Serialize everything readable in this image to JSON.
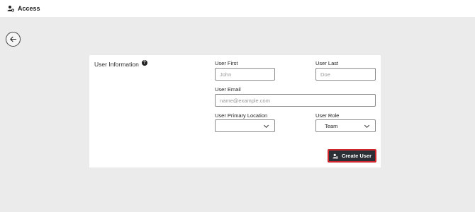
{
  "header": {
    "title": "Access",
    "icon": "user-gear-icon"
  },
  "back": {
    "icon": "arrow-left-icon"
  },
  "form": {
    "section_label": "User Information",
    "help_icon": "question-circle-icon",
    "user_first": {
      "label": "User First",
      "placeholder": "John",
      "value": ""
    },
    "user_last": {
      "label": "User Last",
      "placeholder": "Doe",
      "value": ""
    },
    "user_email": {
      "label": "User Email",
      "placeholder": "name@example.com",
      "value": ""
    },
    "primary_location": {
      "label": "User Primary Location",
      "value": ""
    },
    "user_role": {
      "label": "User Role",
      "value": "Team"
    }
  },
  "actions": {
    "create_label": "Create User",
    "create_icon": "user-gear-icon"
  },
  "colors": {
    "accent_border": "#d0262c",
    "button_bg": "#2b3037",
    "page_bg": "#ebebec"
  }
}
